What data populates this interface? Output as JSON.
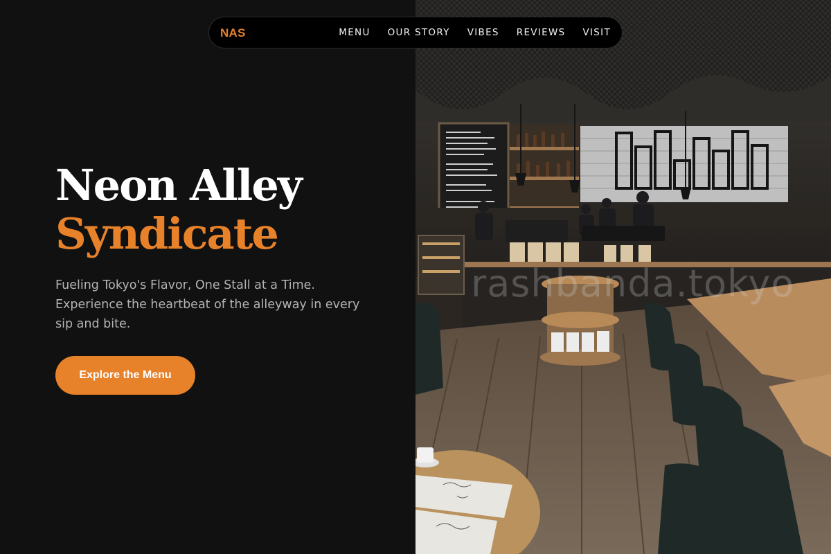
{
  "nav": {
    "logo": "NAS",
    "links": [
      "MENU",
      "OUR STORY",
      "VIBES",
      "REVIEWS",
      "VISIT"
    ]
  },
  "hero": {
    "title_line_1": "Neon Alley",
    "title_line_2": "Syndicate",
    "description": "Fueling Tokyo's Flavor, One Stall at a Time. Experience the heartbeat of the alleyway in every sip and bite.",
    "cta_label": "Explore the Menu"
  },
  "image": {
    "watermark": "rashbanda.tokyo"
  },
  "colors": {
    "accent": "#e8822a",
    "background": "#111111",
    "text_primary": "#ffffff",
    "text_muted": "#b4b4b4"
  }
}
